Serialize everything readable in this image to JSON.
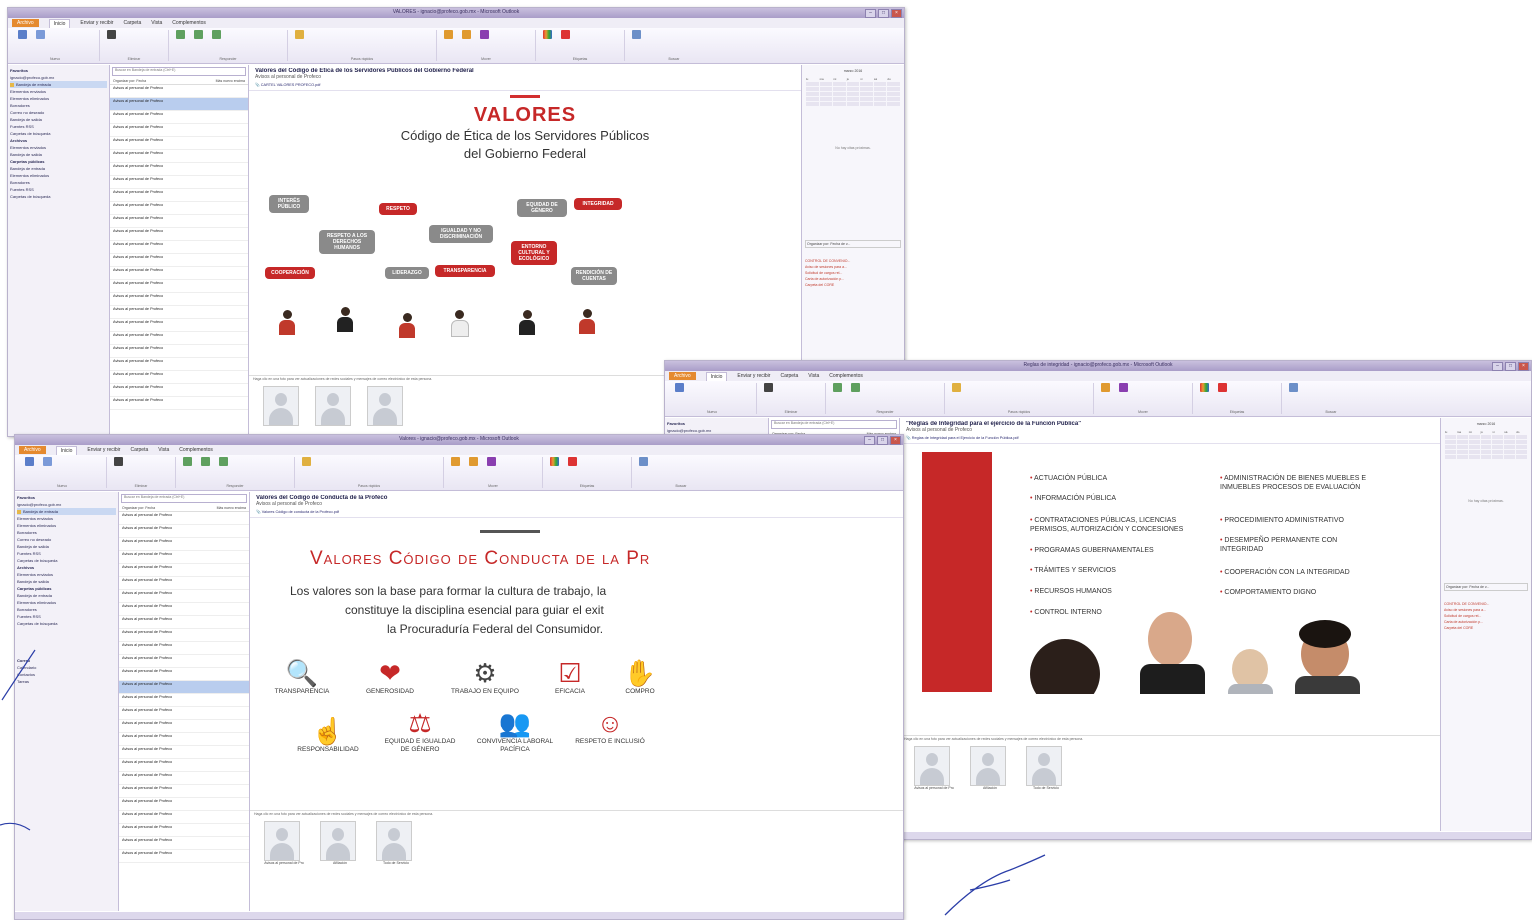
{
  "ribbon_tabs": [
    "Archivo",
    "Inicio",
    "Enviar y recibir",
    "Carpeta",
    "Vista",
    "Complementos"
  ],
  "ribbon_groups": [
    "Nuevo",
    "Eliminar",
    "Responder",
    "Pasos rápidos",
    "Mover",
    "Etiquetas",
    "Buscar"
  ],
  "window1": {
    "title": "VALORES - ignacio@profeco.gob.mx - Microsoft Outlook",
    "subject": "Valores del Código de Ética de los Servidores Públicos del Gobierno Federal",
    "from": "Avisos al personal de Profeco",
    "attachment": "CARTEL VALORES PROFECO.pdf",
    "image": {
      "heading": "VALORES",
      "line1": "Código de Ética de los Servidores Públicos",
      "line2": "del Gobierno Federal",
      "bubbles": [
        "INTERÉS PÚBLICO",
        "RESPETO",
        "IGUALDAD Y NO DISCRIMINACIÓN",
        "INTEGRIDAD",
        "RESPETO A LOS DERECHOS HUMANOS",
        "EQUIDAD DE GÉNERO",
        "ENTORNO CULTURAL Y ECOLÓGICO",
        "COOPERACIÓN",
        "LIDERAZGO",
        "TRANSPARENCIA",
        "RENDICIÓN DE CUENTAS"
      ]
    },
    "people_bar": "Haga clic en una foto para ver actualizaciones de redes sociales y mensajes de correo electrónico de esta persona."
  },
  "window2": {
    "title": "Valores - ignacio@profeco.gob.mx - Microsoft Outlook",
    "subject": "Valores del Código de Conducta de la Profeco",
    "from": "Avisos al personal de Profeco",
    "attachment": "Valores Código de conducta de la Profeco.pdf",
    "image": {
      "heading": "Valores Código de Conducta de la Pr",
      "line1": "Los valores son la base para formar la cultura de trabajo, la",
      "line2": "constituye la disciplina esencial para guiar el exit",
      "line3": "la Procuraduría Federal del Consumidor.",
      "values_row1": [
        "TRANSPARENCIA",
        "GENEROSIDAD",
        "TRABAJO EN EQUIPO",
        "EFICACIA",
        "COMPRO"
      ],
      "values_row2": [
        "RESPONSABILIDAD",
        "EQUIDAD E IGUALDAD DE GÉNERO",
        "CONVIVENCIA LABORAL PACÍFICA",
        "RESPETO E INCLUSIÓ"
      ]
    },
    "people_bar": "Haga clic en una foto para ver actualizaciones de redes sociales y mensajes de correo electrónico de esta persona.",
    "avatar_names": [
      "Avisos al personal de Pro",
      "Afiliación",
      "Todo de Servicio"
    ],
    "nav_bottom": [
      "Correo",
      "Calendario",
      "Contactos",
      "Tareas"
    ]
  },
  "window3": {
    "title": "Reglas de integridad - ignacio@profeco.gob.mx - Microsoft Outlook",
    "subject": "\"Reglas de Integridad para el ejercicio de la Función Pública\"",
    "from": "Avisos al personal de Profeco",
    "attachment": "Reglas de Integridad para el Ejercicio de la Función Pública.pdf",
    "bullets_left": [
      "ACTUACIÓN PÚBLICA",
      "INFORMACIÓN PÚBLICA",
      "CONTRATACIONES PÚBLICAS, LICENCIAS PERMISOS, AUTORIZACIÓN Y CONCESIONES",
      "PROGRAMAS GUBERNAMENTALES",
      "TRÁMITES Y SERVICIOS",
      "RECURSOS HUMANOS",
      "CONTROL INTERNO"
    ],
    "bullets_right": [
      "ADMINISTRACIÓN DE BIENES MUEBLES E INMUEBLES PROCESOS DE EVALUACIÓN",
      "PROCEDIMIENTO ADMINISTRATIVO",
      "DESEMPEÑO PERMANENTE CON INTEGRIDAD",
      "COOPERACIÓN CON LA INTEGRIDAD",
      "COMPORTAMIENTO DIGNO"
    ],
    "people_bar": "Haga clic en una foto para ver actualizaciones de redes sociales y mensajes de correo electrónico de esta persona.",
    "avatar_names": [
      "Avisos al personal de Pro",
      "Afiliación",
      "Todo de Servicio"
    ],
    "todo_noapt": "No hay citas próximas.",
    "tasks": [
      "CONTROL DE CONVENIO...",
      "Aviso de sesiones para a...",
      "Solicitud de cargos rel...",
      "Carta de autorización p...",
      "Carpeta del CORE"
    ]
  },
  "todo": {
    "month": "marzo 2016",
    "days": [
      "lu",
      "ma",
      "mi",
      "ju",
      "vi",
      "sá",
      "do"
    ],
    "noapt": "No hay citas próximas.",
    "arrange": "Organizar por: Fecha de v...",
    "tasks": [
      "CONTROL DE CONVENIO...",
      "Aviso de sesiones para a...",
      "Solicitud de cargos rel...",
      "Carta de autorización p...",
      "Carpeta del CORE"
    ]
  },
  "list": {
    "search": "Buscar en Bandeja de entrada (Ctrl+E)",
    "sort": "Organizar por: Fecha",
    "sort_order": "Más nuevo encima",
    "sender": "Avisos al personal de Profeco"
  },
  "nav_folders": [
    "Favoritos",
    "ignacio@profeco.gob.mx",
    "Bandeja de entrada",
    "Elementos enviados",
    "Elementos eliminados",
    "Borradores",
    "Correo no deseado",
    "Bandeja de salida",
    "Fuentes RSS",
    "Carpetas de búsqueda",
    "Archivos",
    "Carpetas públicas"
  ],
  "colors": {
    "accent_red": "#c62828",
    "ribbon": "#e9e6f3",
    "titlebar": "#a99dc8",
    "file_tab": "#e58a2f"
  }
}
